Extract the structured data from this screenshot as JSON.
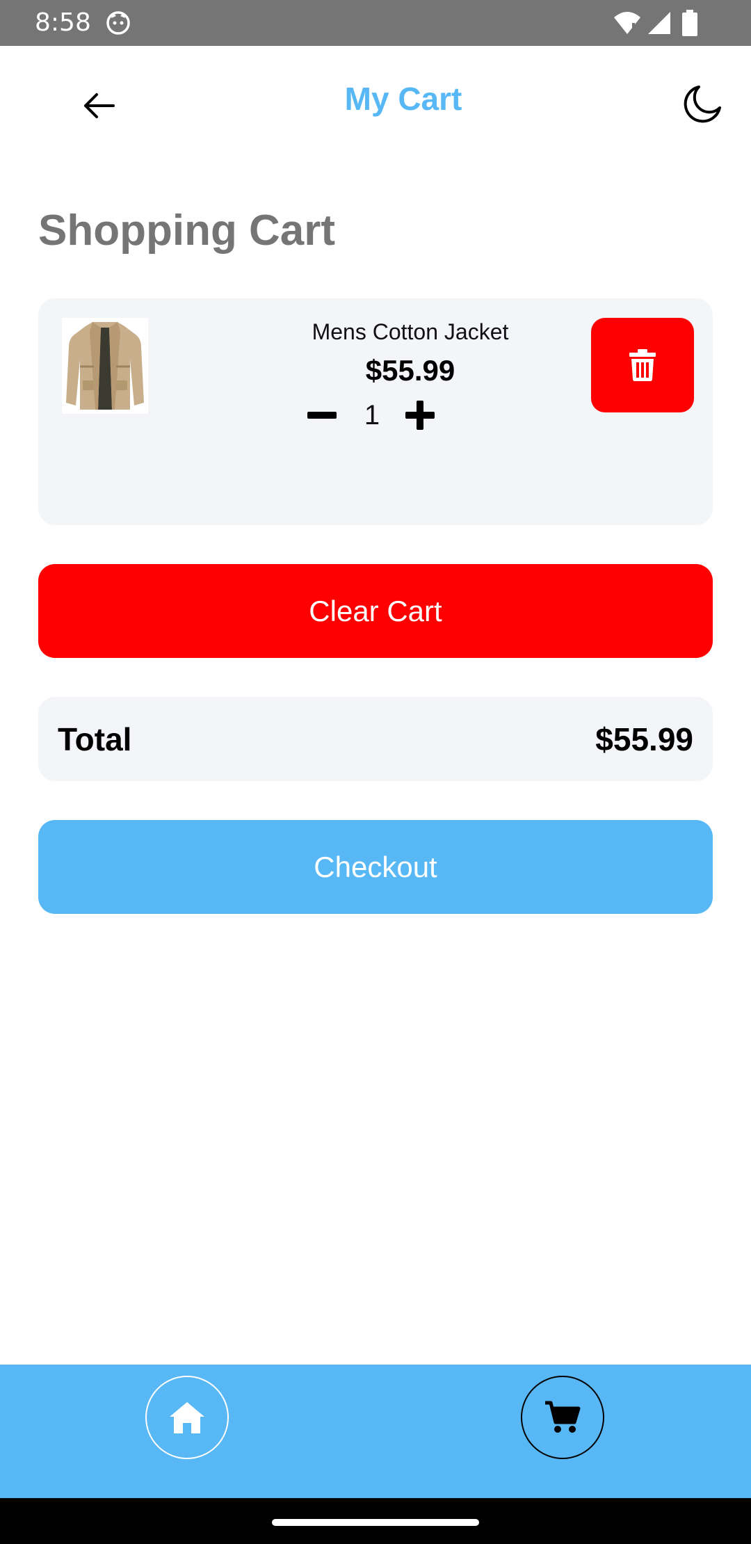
{
  "status_bar": {
    "time": "8:58",
    "icons": [
      "cat-notification-icon",
      "wifi-icon",
      "signal-icon",
      "battery-icon"
    ]
  },
  "app_bar": {
    "title": "My Cart",
    "back_icon": "arrow-left-icon",
    "theme_icon": "moon-icon"
  },
  "section_title": "Shopping Cart",
  "cart_items": [
    {
      "name": "Mens Cotton Jacket",
      "price": "$55.99",
      "quantity": "1",
      "image": "jacket-image"
    }
  ],
  "clear_button": "Clear Cart",
  "total": {
    "label": "Total",
    "value": "$55.99"
  },
  "checkout_button": "Checkout",
  "bottom_nav": {
    "items": [
      "home-icon",
      "cart-icon"
    ]
  },
  "colors": {
    "accent": "#58b8f5",
    "danger": "#ff0000",
    "card_bg": "#f4f5f9",
    "heading_gray": "#757575",
    "status_bar": "#757575"
  }
}
